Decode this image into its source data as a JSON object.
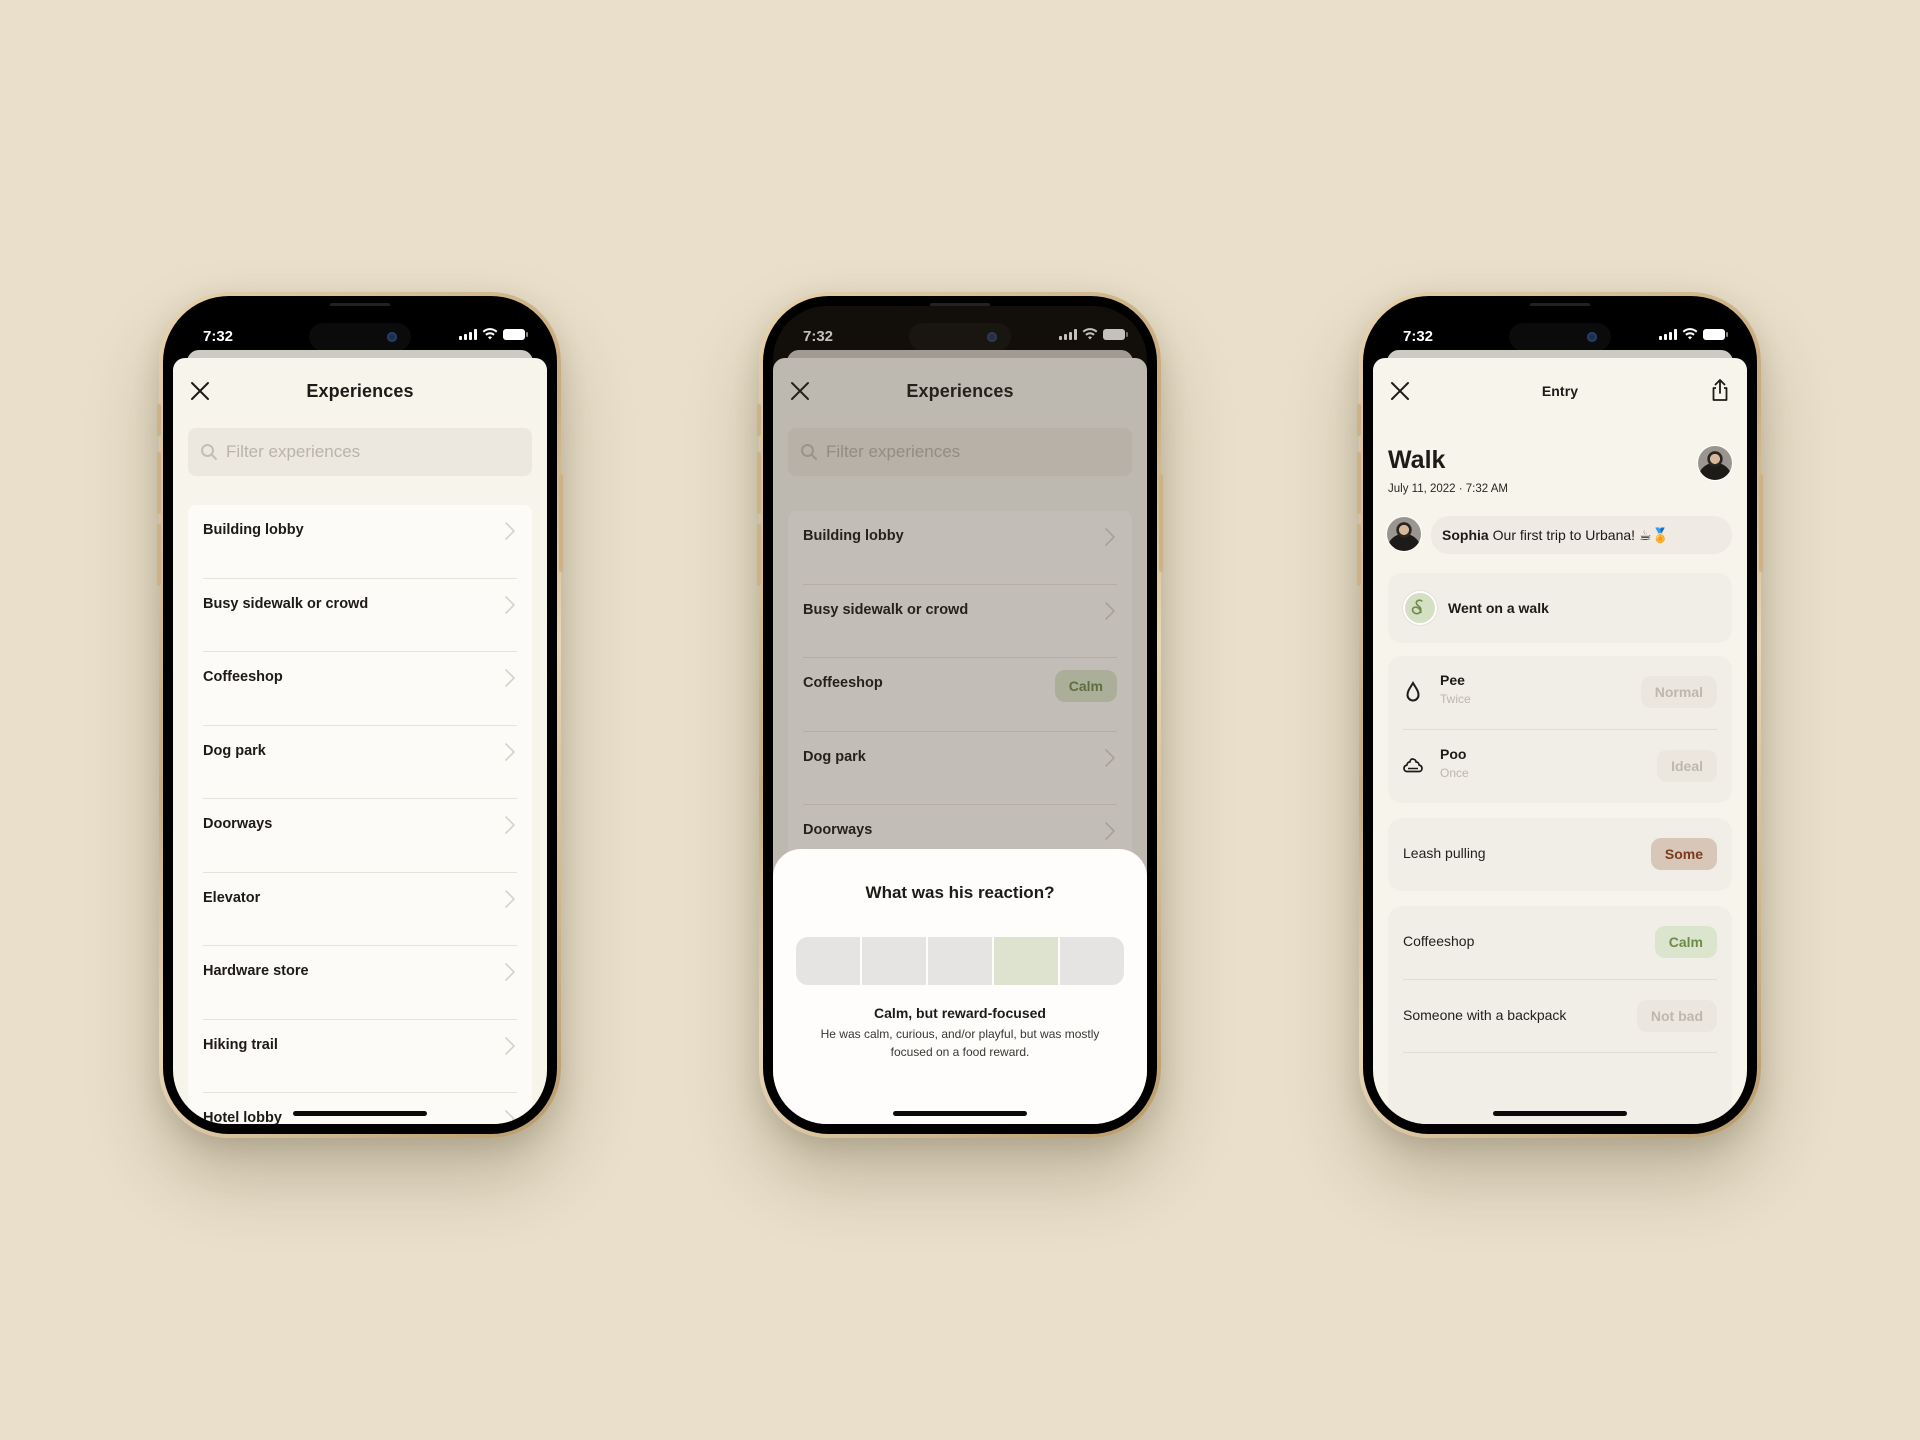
{
  "colors": {
    "background": "#e9dfca",
    "calm_pill_bg": "#dbe4cc",
    "calm_pill_text": "#6e8a4a",
    "some_pill_bg": "#d8c6b8",
    "some_pill_text": "#7a3a1c",
    "muted_pill_bg": "#ebe7df",
    "muted_pill_text": "#bdb7ad",
    "selected_segment": "#dde3cf"
  },
  "phones": [
    {
      "status": {
        "time": "7:32",
        "signal_icon": "cellular-signal-icon",
        "wifi_icon": "wifi-icon",
        "battery_icon": "battery-icon"
      },
      "header": {
        "title": "Experiences",
        "close_icon": "close-icon"
      },
      "search": {
        "placeholder": "Filter experiences",
        "value": ""
      },
      "items": [
        {
          "label": "Building lobby"
        },
        {
          "label": "Busy sidewalk or crowd"
        },
        {
          "label": "Coffeeshop"
        },
        {
          "label": "Dog park"
        },
        {
          "label": "Doorways"
        },
        {
          "label": "Elevator"
        },
        {
          "label": "Hardware store"
        },
        {
          "label": "Hiking trail"
        },
        {
          "label": "Hotel lobby"
        }
      ]
    },
    {
      "status": {
        "time": "7:32"
      },
      "header": {
        "title": "Experiences"
      },
      "search": {
        "placeholder": "Filter experiences",
        "value": ""
      },
      "items": [
        {
          "label": "Building lobby"
        },
        {
          "label": "Busy sidewalk or crowd"
        },
        {
          "label": "Coffeeshop",
          "badge": "Calm"
        },
        {
          "label": "Dog park"
        },
        {
          "label": "Doorways"
        }
      ],
      "reaction_sheet": {
        "question": "What was his reaction?",
        "scale_segments": 5,
        "selected_index": 3,
        "selected_title": "Calm, but reward-focused",
        "selected_description": "He was calm, curious, and/or playful, but was mostly focused on a food reward."
      }
    },
    {
      "status": {
        "time": "7:32"
      },
      "header": {
        "title": "Entry",
        "close_icon": "close-icon",
        "share_icon": "share-icon"
      },
      "entry": {
        "title": "Walk",
        "date": "July 11, 2022 · 7:32 AM",
        "comment_author": "Sophia",
        "comment_text": "Our first trip to Urbana! ☕🏅",
        "activity": "Went on a walk",
        "potty": [
          {
            "label": "Pee",
            "sub": "Twice",
            "value": "Normal",
            "icon": "droplet-icon"
          },
          {
            "label": "Poo",
            "sub": "Once",
            "value": "Ideal",
            "icon": "poop-icon"
          }
        ],
        "leash": {
          "label": "Leash pulling",
          "value": "Some"
        },
        "experiences": [
          {
            "label": "Coffeeshop",
            "value": "Calm"
          },
          {
            "label": "Someone with a backpack",
            "value": "Not bad"
          }
        ]
      }
    }
  ]
}
